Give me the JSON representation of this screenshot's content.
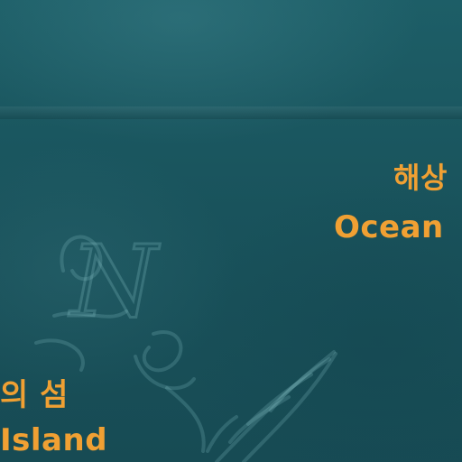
{
  "map": {
    "background_color": "#19535c",
    "label_color": "#f0a033",
    "compass_glyph": "N",
    "compass_icon": "compass-rose-icon",
    "labels": {
      "ocean_ko": "해상",
      "ocean_en": "Ocean",
      "island_ko": "의 섬",
      "island_en": "Island"
    }
  }
}
